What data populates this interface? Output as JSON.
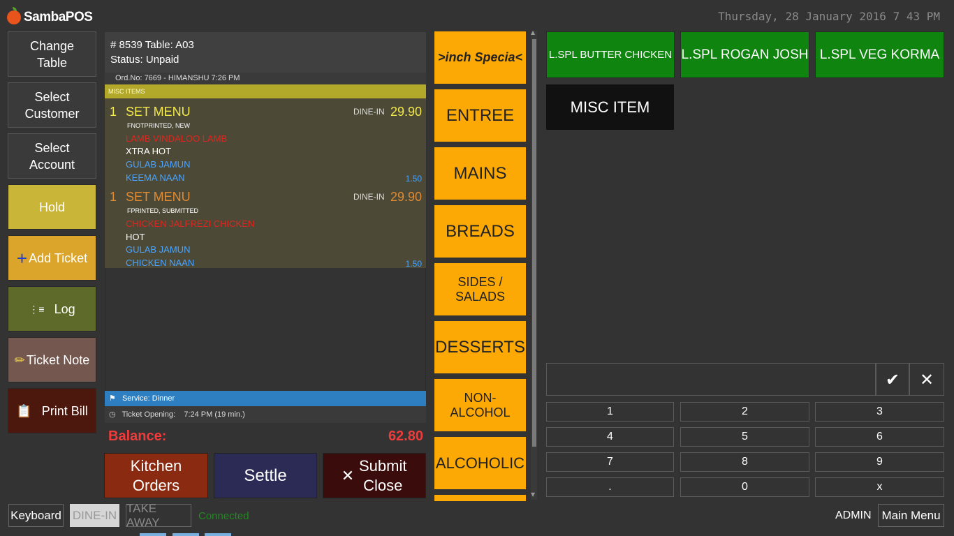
{
  "app": {
    "title": "SambaPOS"
  },
  "header": {
    "datetime": "Thursday, 28 January 2016 7 43 PM"
  },
  "left_buttons": [
    {
      "label": "Change Table",
      "color": "#3a3a3a"
    },
    {
      "label": "Select Customer",
      "color": "#3a3a3a"
    },
    {
      "label": "Select Account",
      "color": "#3a3a3a"
    },
    {
      "label": "Hold",
      "color": "#c9b537"
    },
    {
      "label": "Add Ticket",
      "color": "#dba52b"
    },
    {
      "label": "Log",
      "color": "#5e6a2a"
    },
    {
      "label": "Ticket Note",
      "color": "#745850"
    },
    {
      "label": "Print Bill",
      "color": "#4c170c"
    }
  ],
  "ticket": {
    "number_line": "# 8539 Table: A03",
    "status_line": "Status: Unpaid",
    "order_line": "Ord.No: 7669 - HIMANSHU  7:26 PM",
    "group_label": "MISC ITEMS",
    "items": [
      {
        "qty": "1",
        "name": "SET MENU",
        "type": "DINE-IN",
        "price": "29.90",
        "states": "FNOTPRINTED, NEW",
        "modifiers": [
          "LAMB VINDALOO LAMB",
          "XTRA HOT",
          "GULAB JAMUN",
          "KEEMA NAAN"
        ],
        "mod_price": "1.50"
      },
      {
        "qty": "1",
        "name": "SET MENU",
        "type": "DINE-IN",
        "price": "29.90",
        "states": "FPRINTED, SUBMITTED",
        "modifiers": [
          "CHICKEN JALFREZI CHICKEN",
          "HOT",
          "GULAB JAMUN",
          "CHICKEN NAAN"
        ],
        "mod_price": "1.50"
      }
    ],
    "service": "Service: Dinner",
    "opening": "Ticket Opening:    7:24 PM (19 min.)",
    "balance_label": "Balance:",
    "balance_value": "62.80"
  },
  "bottom_buttons": {
    "kitchen_orders": "Kitchen Orders",
    "settle": "Settle",
    "submit_close": "Submit Close"
  },
  "categories": [
    ">inch Specia<",
    "ENTREE",
    "MAINS",
    "BREADS",
    "SIDES / SALADS",
    "DESSERTS",
    "NON-ALCOHOL",
    "ALCOHOLIC"
  ],
  "menu_items": [
    "L.SPL BUTTER CHICKEN",
    "L.SPL ROGAN JOSH",
    "L.SPL VEG KORMA"
  ],
  "misc_item": "MISC ITEM",
  "numpad": {
    "ok_icon": "✔",
    "cancel_icon": "✕",
    "keys": [
      "1",
      "2",
      "3",
      "4",
      "5",
      "6",
      "7",
      "8",
      "9",
      ".",
      "0",
      "x"
    ]
  },
  "footer": {
    "keyboard": "Keyboard",
    "dine_in": "DINE-IN",
    "take_away": "TAKE AWAY",
    "connected": "Connected",
    "user": "ADMIN",
    "main_menu": "Main Menu"
  },
  "colors": {
    "category_bg": "#fca905",
    "menu_item_bg": "#0f840f",
    "balance": "#ef3b3b",
    "service_bar": "#2d7fc1"
  }
}
